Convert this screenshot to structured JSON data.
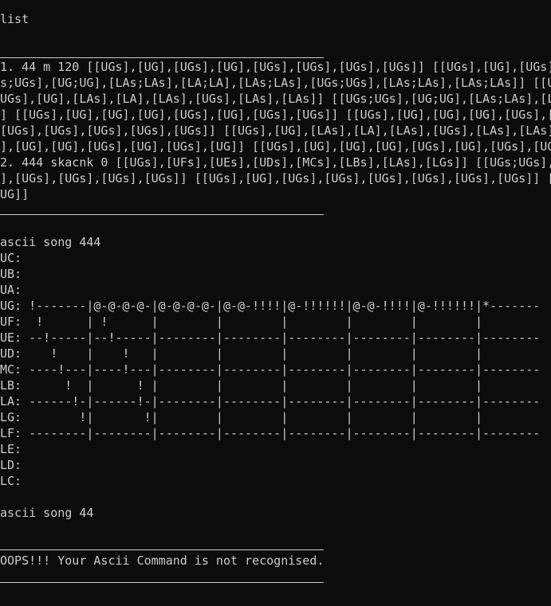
{
  "colors": {
    "background": "#0c0c0c",
    "foreground": "#cccccc"
  },
  "commands": {
    "list": "list",
    "song444": "ascii song 444",
    "song44": "ascii song 44"
  },
  "list_output": [
    "1. 44 m 120 [[UGs],[UG],[UGs],[UG],[UGs],[UGs],[UGs],[UGs]] [[UGs],[UG],[UGs],",
    "s;UGs],[UG;UG],[LAs;LAs],[LA;LA],[LAs;LAs],[UGs;UGs],[LAs;LAs],[LAs;LAs]] [[UG",
    "UGs],[UG],[LAs],[LA],[LAs],[UGs],[LAs],[LAs]] [[UGs;UGs],[UG;UG],[LAs;LAs],[LA",
    "] [[UGs],[UG],[UG],[UG],[UGs],[UG],[UGs],[UGs]] [[UGs],[UG],[UG],[UG],[UGs],[U",
    "[UGs],[UGs],[UGs],[UGs],[UGs]] [[UGs],[UG],[LAs],[LA],[LAs],[UGs],[LAs],[LAs]",
    "],[UG],[UG],[UGs],[UG],[UGs],[UG]] [[UGs],[UG],[UG],[UG],[UGs],[UG],[UGs],[UG",
    "2. 444 skacnk 0 [[UGs],[UFs],[UEs],[UDs],[MCs],[LBs],[LAs],[LGs]] [[UGs;UGs],[",
    "],[UGs],[UGs],[UGs],[UGs]] [[UGs],[UG],[UGs],[UGs],[UGs],[UGs],[UGs],[UGs]] [[",
    "UG]]"
  ],
  "song_lines": [
    "UC:",
    "UB:",
    "UA:",
    "UG: !-------|@-@-@-@-|@-@-@-@-|@-@-!!!!|@-!!!!!!|@-@-!!!!|@-!!!!!!|*-------",
    "UF:  !      | !      |        |        |        |        |        |",
    "UE: --!-----|--!-----|--------|--------|--------|--------|--------|--------",
    "UD:    !    |    !   |        |        |        |        |        |",
    "MC: ----!---|----!---|--------|--------|--------|--------|--------|--------",
    "LB:      !  |      ! |        |        |        |        |        |",
    "LA: ------!-|------!-|--------|--------|--------|--------|--------|--------",
    "LG:        !|       !|        |        |        |        |        |",
    "LF: --------|--------|--------|--------|--------|--------|--------|--------",
    "LE:",
    "LD:",
    "LC:"
  ],
  "error_message": "OOPS!!! Your Ascii Command is not recognised."
}
